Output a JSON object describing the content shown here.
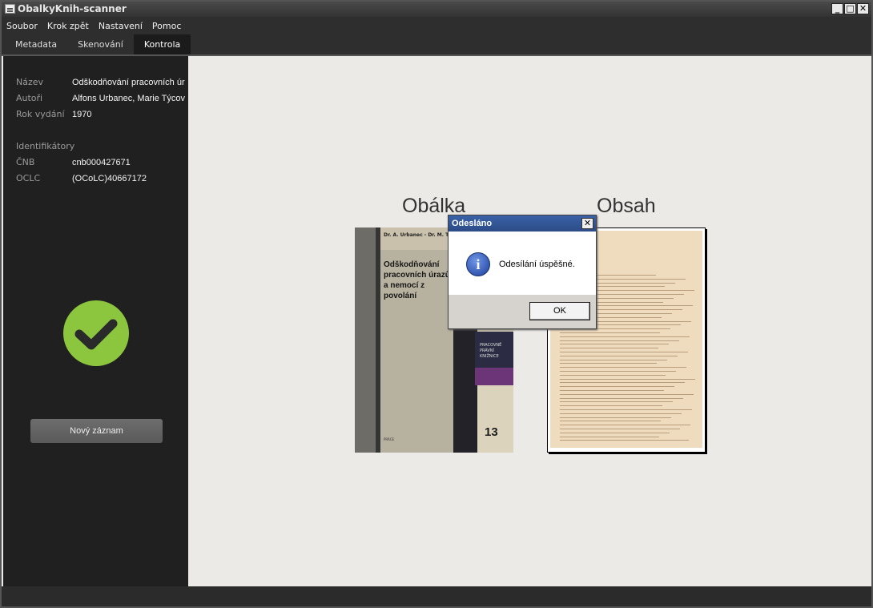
{
  "window": {
    "title": "ObalkyKnih-scanner"
  },
  "menu": [
    "Soubor",
    "Krok zpět",
    "Nastavení",
    "Pomoc"
  ],
  "tabs": [
    {
      "label": "Metadata",
      "active": false
    },
    {
      "label": "Skenování",
      "active": false
    },
    {
      "label": "Kontrola",
      "active": true
    }
  ],
  "sidebar": {
    "fields": [
      {
        "label": "Název",
        "value": "Odškodňování pracovních úr"
      },
      {
        "label": "Autoři",
        "value": "Alfons Urbanec, Marie Týcov"
      },
      {
        "label": "Rok vydání",
        "value": "1970"
      }
    ],
    "identifiers_heading": "Identifikátory",
    "identifiers": [
      {
        "label": "ČNB",
        "value": "cnb000427671"
      },
      {
        "label": "OCLC",
        "value": "(OCoLC)40667172"
      }
    ],
    "status_icon": "checkmark-icon",
    "status_color": "#8cc63f",
    "new_record_button": "Nový záznam"
  },
  "preview": {
    "cover_label": "Obálka",
    "toc_label": "Obsah",
    "cover_book": {
      "authors": "Dr. A. Urbanec - Dr. M. Týcová",
      "title": "Odškodňování pracovních úrazů a nemocí z povolání",
      "series": "PRACOVNĚ PRÁVNÍ KNIŽNICE",
      "number": "13",
      "publisher": "PRÁCE"
    }
  },
  "dialog": {
    "title": "Odesláno",
    "message": "Odesílání úspěšné.",
    "ok_label": "OK",
    "icon": "info-icon",
    "accent": "#2c4b86"
  }
}
